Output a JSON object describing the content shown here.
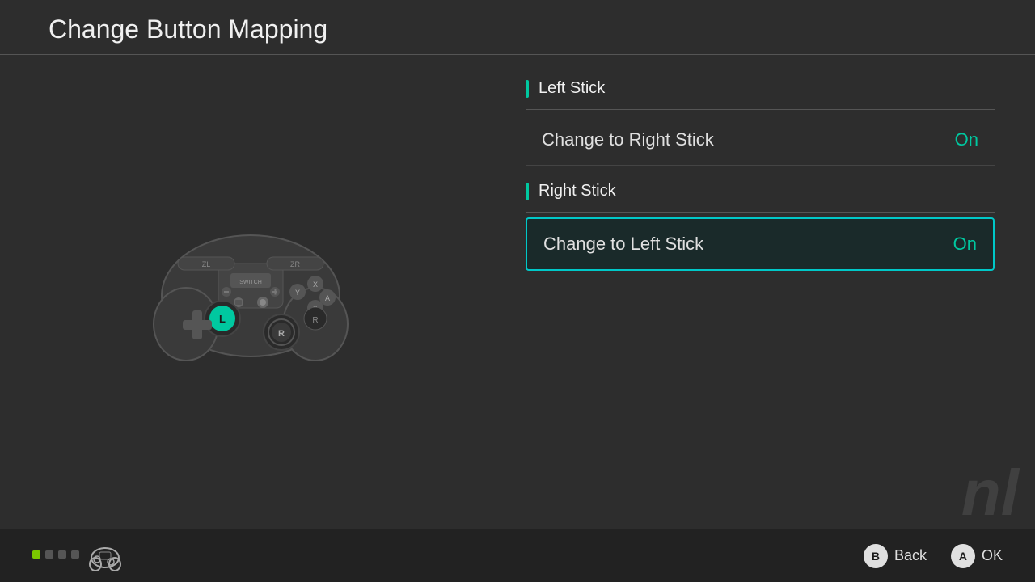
{
  "header": {
    "title": "Change Button Mapping"
  },
  "sections": [
    {
      "id": "left-stick",
      "title": "Left Stick",
      "settings": [
        {
          "label": "Change to Right Stick",
          "value": "On",
          "selected": false
        }
      ]
    },
    {
      "id": "right-stick",
      "title": "Right Stick",
      "settings": [
        {
          "label": "Change to Left Stick",
          "value": "On",
          "selected": true
        }
      ]
    }
  ],
  "footer": {
    "back_label": "Back",
    "ok_label": "OK",
    "b_button": "B",
    "a_button": "A",
    "dots": [
      "green",
      "gray",
      "gray",
      "gray"
    ]
  }
}
